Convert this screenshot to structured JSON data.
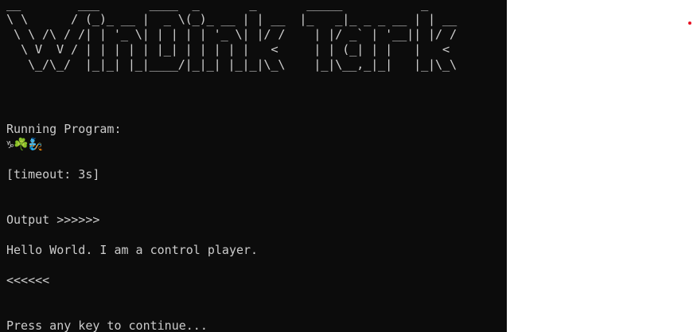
{
  "terminal": {
    "banner": "__        ___       ____  _       _       _____           _\n\\ \\      / (_)_ __ |  _ \\(_)_ __ | | __  |_   _|_ _ _ __ | | __\n \\ \\ /\\ / /| | '_ \\| | | | | '_ \\| |/ /    | |/ _` | '__|| |/ /\n  \\ V  V / | | | | | |_| | | | | |   <     | | (_| | |   |   <\n   \\_/\\_/  |_|_| |_|____/|_|_| |_|_|\\_\\    |_|\\__,_|_|   |_|\\_\\",
    "running_label": "Running Program:",
    "program_emoji": "♑☘️🧞",
    "timeout_text": "[timeout: 3s]",
    "output_header": "Output >>>>>>",
    "output_text": "Hello World. I am a control player.",
    "output_footer": "<<<<<<",
    "continue_prompt": "Press any key to continue..."
  },
  "colors": {
    "terminal_bg": "#0c0c0c",
    "terminal_fg": "#cccccc",
    "page_bg": "#ffffff",
    "dot": "#e81123"
  }
}
